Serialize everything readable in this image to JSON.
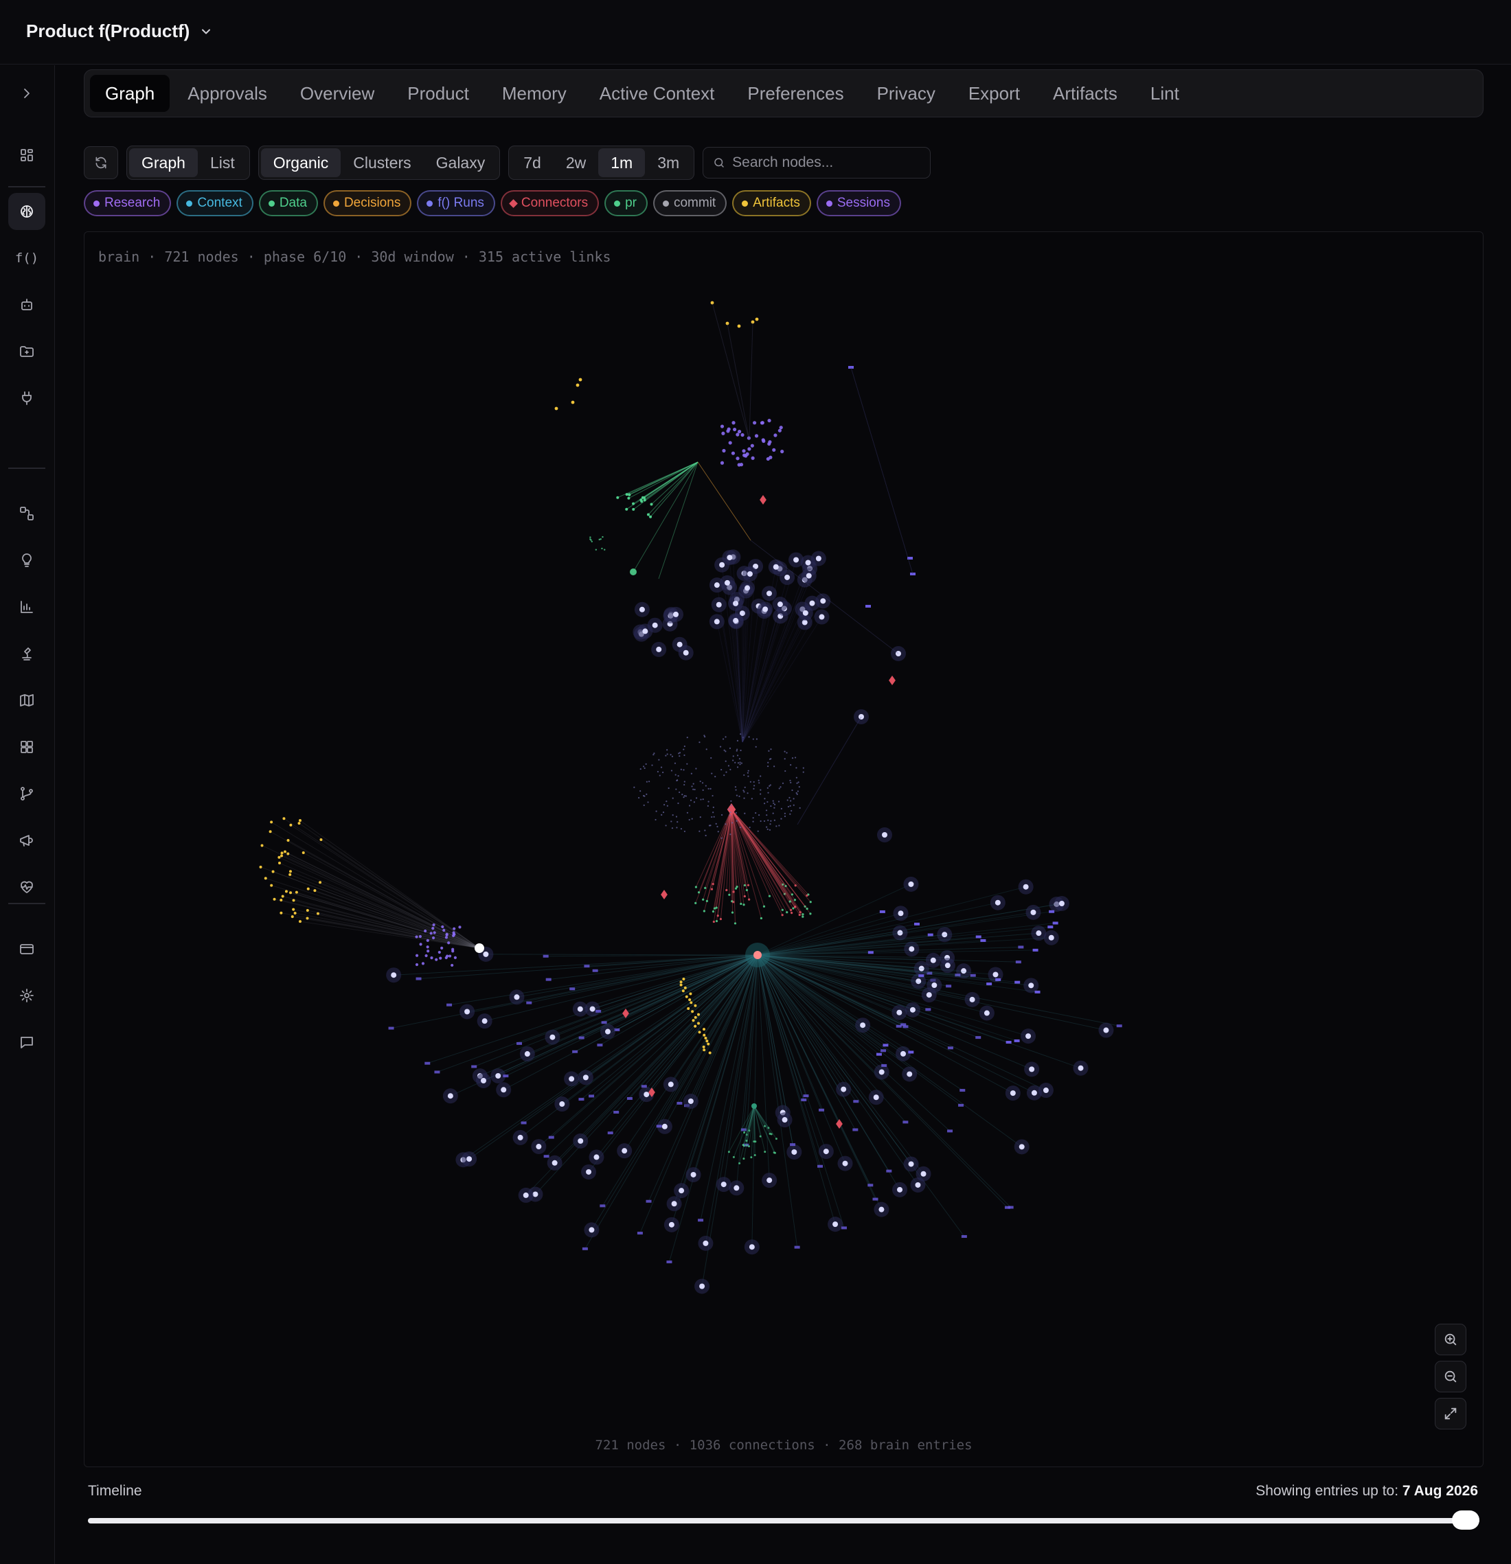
{
  "project": {
    "name": "Product f(Productf)"
  },
  "tabs": [
    "Graph",
    "Approvals",
    "Overview",
    "Product",
    "Memory",
    "Active Context",
    "Preferences",
    "Privacy",
    "Export",
    "Artifacts",
    "Lint"
  ],
  "active_tab": "Graph",
  "view_toggle": [
    "Graph",
    "List"
  ],
  "layout_toggle": [
    "Organic",
    "Clusters",
    "Galaxy"
  ],
  "range_toggle": [
    "7d",
    "2w",
    "1m",
    "3m"
  ],
  "active": {
    "view": "Graph",
    "layout": "Organic",
    "range": "1m"
  },
  "search": {
    "placeholder": "Search nodes...",
    "value": ""
  },
  "filters": [
    {
      "label": "Research",
      "color": "#a06cf2",
      "shape": "dot"
    },
    {
      "label": "Context",
      "color": "#47b9e0",
      "shape": "dot"
    },
    {
      "label": "Data",
      "color": "#4fcf8c",
      "shape": "dot"
    },
    {
      "label": "Decisions",
      "color": "#f0a53a",
      "shape": "dot"
    },
    {
      "label": "f() Runs",
      "color": "#7b7bf0",
      "shape": "dot"
    },
    {
      "label": "Connectors",
      "color": "#e0505f",
      "shape": "diamond"
    },
    {
      "label": "pr",
      "color": "#4fcf8c",
      "shape": "dot"
    },
    {
      "label": "commit",
      "color": "#a5a5ae",
      "shape": "dot"
    },
    {
      "label": "Artifacts",
      "color": "#f0c43a",
      "shape": "dot"
    },
    {
      "label": "Sessions",
      "color": "#9a6cf2",
      "shape": "dot"
    }
  ],
  "graph": {
    "meta": "brain · 721 nodes · phase 6/10 · 30d window · 315 active links",
    "stats": "721 nodes · 1036 connections · 268 brain entries"
  },
  "sidebar_icons": [
    "expand-icon",
    "dashboard-icon",
    "brain-icon",
    "function-icon",
    "bot-icon",
    "folder-icon",
    "plug-icon",
    "workflow-icon",
    "lightbulb-icon",
    "chart-icon",
    "microscope-icon",
    "map-icon",
    "grid-icon",
    "git-branch-icon",
    "megaphone-icon",
    "heart-pulse-icon",
    "card-icon",
    "settings-icon",
    "chat-icon"
  ],
  "timeline": {
    "label": "Timeline",
    "status_prefix": "Showing entries up to:",
    "date": "7 Aug 2026",
    "position": 1.0
  }
}
